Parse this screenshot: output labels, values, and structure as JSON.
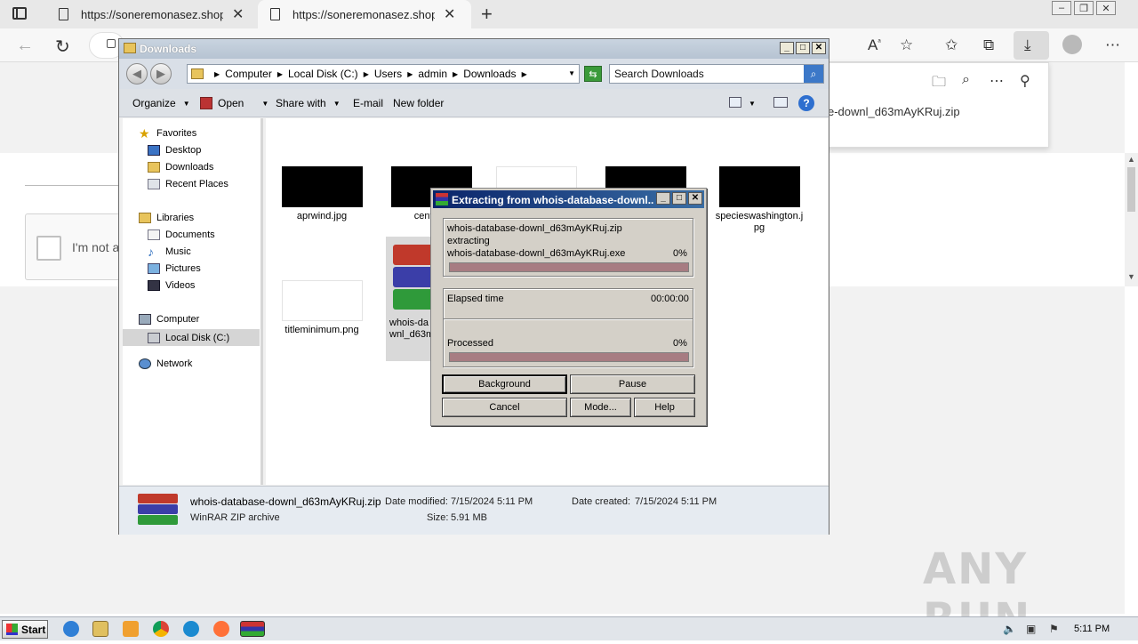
{
  "browser": {
    "tabs": [
      {
        "label": "https://soneremonasez.shop/d"
      },
      {
        "label": "https://soneremonasez.shop/d"
      }
    ],
    "downloads_panel_filename": "e-downl_d63mAyKRuj.zip"
  },
  "page": {
    "captcha_text": "I'm not a"
  },
  "explorer": {
    "title": "Downloads",
    "breadcrumb": [
      "Computer",
      "Local Disk (C:)",
      "Users",
      "admin",
      "Downloads"
    ],
    "search_placeholder": "Search Downloads",
    "commands": {
      "organize": "Organize",
      "open": "Open",
      "share_with": "Share with",
      "email": "E-mail",
      "new_folder": "New folder"
    },
    "nav": {
      "favorites": "Favorites",
      "desktop": "Desktop",
      "downloads": "Downloads",
      "recent_places": "Recent Places",
      "libraries": "Libraries",
      "documents": "Documents",
      "music": "Music",
      "pictures": "Pictures",
      "videos": "Videos",
      "computer": "Computer",
      "local_disk": "Local Disk (C:)",
      "network": "Network"
    },
    "files": [
      {
        "name": "aprwind.jpg"
      },
      {
        "name": "centralc"
      },
      {
        "name": "specieswashington.jpg"
      },
      {
        "name": "titleminimum.png"
      },
      {
        "name": "whois-database-downl_d63mAyKRuj.zip",
        "visible_caption": "whois-da\nwnl_d63m"
      }
    ],
    "details": {
      "filename": "whois-database-downl_d63mAyKRuj.zip",
      "type": "WinRAR ZIP archive",
      "date_modified_label": "Date modified:",
      "date_modified": "7/15/2024 5:11 PM",
      "date_created_label": "Date created:",
      "date_created": "7/15/2024 5:11 PM",
      "size_label": "Size:",
      "size": "5.91 MB"
    }
  },
  "winrar": {
    "title": "Extracting from whois-database-downl...",
    "archive": "whois-database-downl_d63mAyKRuj.zip",
    "action": "extracting",
    "current_file": "whois-database-downl_d63mAyKRuj.exe",
    "file_percent": "0%",
    "elapsed_label": "Elapsed time",
    "elapsed": "00:00:00",
    "processed_label": "Processed",
    "processed_percent": "0%",
    "buttons": {
      "background": "Background",
      "pause": "Pause",
      "cancel": "Cancel",
      "mode": "Mode...",
      "help": "Help"
    }
  },
  "taskbar": {
    "start": "Start",
    "clock": "5:11 PM"
  },
  "watermark": "ANY RUN"
}
